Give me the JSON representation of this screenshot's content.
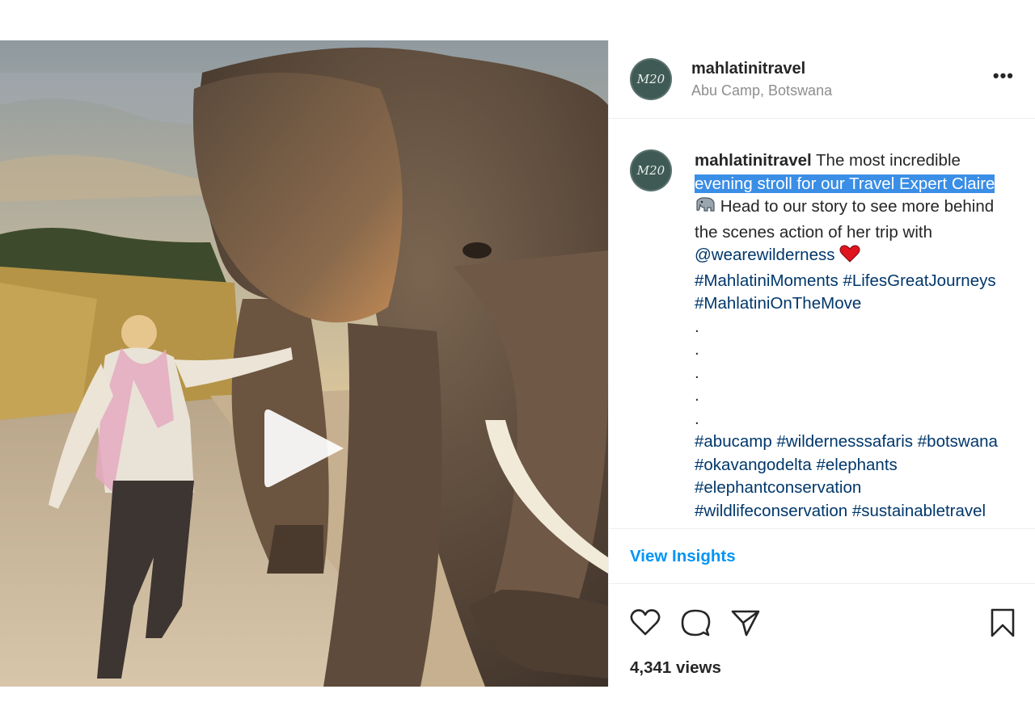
{
  "post": {
    "account": {
      "username": "mahlatinitravel",
      "location": "Abu Camp, Botswana",
      "avatar_text": "M20"
    },
    "caption": {
      "username": "mahlatinitravel",
      "text_intro": " The most incredible",
      "text_highlighted": "evening stroll for our Travel Expert Claire",
      "text_after_emoji": " Head to our story to see more behind the scenes action of her trip with ",
      "mention": "@wearewilderness",
      "hashtags_primary": [
        "#MahlatiniMoments",
        "#LifesGreatJourneys",
        "#MahlatiniOnTheMove"
      ],
      "dots": [
        ".",
        ".",
        ".",
        ".",
        "."
      ],
      "hashtags_secondary": [
        "#abucamp",
        "#wildernesssafaris",
        "#botswana",
        "#okavangodelta",
        "#elephants",
        "#elephantconservation",
        "#wildlifeconservation",
        "#sustainabletravel"
      ]
    },
    "insights_label": "View Insights",
    "views_text": "4,341 views",
    "icons": {
      "more": "more-options-icon",
      "like": "heart-icon",
      "comment": "comment-icon",
      "share": "paper-plane-icon",
      "save": "bookmark-icon",
      "play": "play-icon",
      "emoji_1": "elephant-emoji",
      "emoji_2": "red-heart-emoji"
    },
    "colors": {
      "link": "#00376b",
      "highlight": "#3a8ee6",
      "insights": "#0095f6",
      "muted": "#8e8e8e"
    }
  }
}
